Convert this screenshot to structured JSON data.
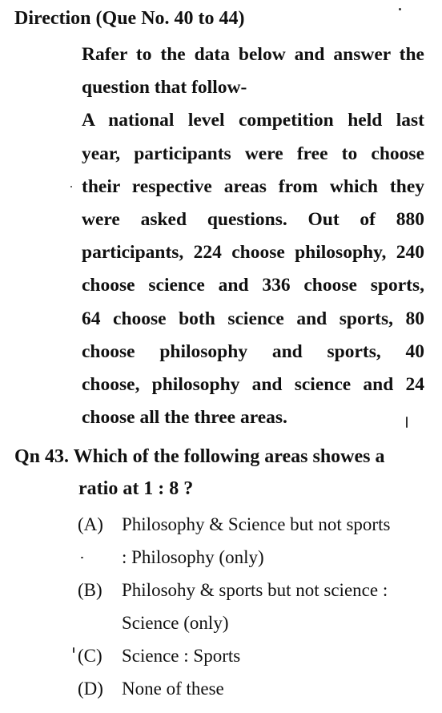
{
  "direction": {
    "title": "Direction (Que No. 40 to 44)"
  },
  "passage": {
    "lines": [
      "Rafer to the data below and answer the",
      "question that follow-",
      "A national level competition held last",
      "year, participants were free to choose",
      "their respective areas from which they",
      "were asked questions. Out of 880",
      "participants, 224 choose philosophy, 240",
      "choose science and 336 choose sports,",
      "64 choose both science and sports, 80",
      "choose philosophy and sports, 40",
      "choose, philosophy and science and 24",
      "choose all the three areas."
    ]
  },
  "question": {
    "number": "Qn 43.",
    "text_line1": "Which of the following areas showes a",
    "text_line2": "ratio at 1 : 8 ?"
  },
  "options": [
    {
      "letter": "(A)",
      "text": "Philosophy & Science but not sports",
      "cont": ": Philosophy (only)"
    },
    {
      "letter": "(B)",
      "text": "Philosohy & sports but not science :",
      "cont": "Science (only)"
    },
    {
      "letter": "(C)",
      "text": "Science : Sports",
      "cont": ""
    },
    {
      "letter": "(D)",
      "text": "None of these",
      "cont": ""
    }
  ]
}
